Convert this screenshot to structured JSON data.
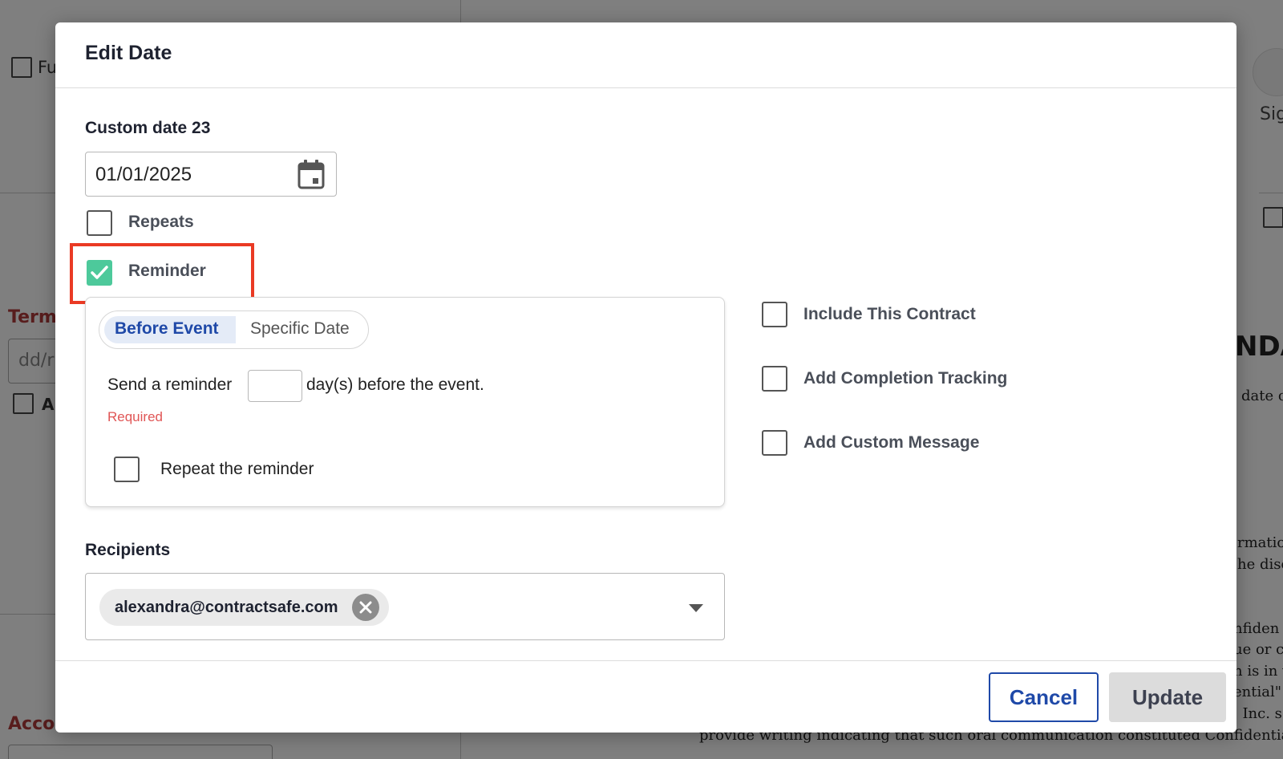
{
  "modal": {
    "title": "Edit Date",
    "date_label": "Custom date 23",
    "date_value": "01/01/2025",
    "repeats_label": "Repeats",
    "reminder_label": "Reminder",
    "reminder_checked": true,
    "reminder_box": {
      "tab_active": "Before Event",
      "tab_inactive": "Specific Date",
      "send_prefix": "Send a reminder",
      "send_suffix": "day(s) before the event.",
      "days_value": "",
      "required": "Required",
      "repeat_label": "Repeat the reminder"
    },
    "options": [
      "Include This Contract",
      "Add Completion Tracking",
      "Add Custom Message"
    ],
    "recipients_label": "Recipients",
    "recipient_email": "alexandra@contractsafe.com",
    "cancel_label": "Cancel",
    "update_label": "Update"
  },
  "background": {
    "left_checkbox_label": "Fu",
    "term_label": "Term",
    "date_placeholder": "dd/r",
    "small_label": "A",
    "account_label": "Acco",
    "right_label": "Sig",
    "doc_heading": "NDA",
    "doc_lines": [
      "date o",
      "rmatio",
      "he discl",
      "nfiden",
      "ue or  c",
      "n is in  v",
      "ential\"",
      ", Inc.  s",
      "provide writing indicating that such oral communication constituted Confidential  Info"
    ]
  },
  "colors": {
    "accent": "#1f49a8",
    "check": "#4dc99b",
    "highlight": "#ea3a24",
    "required": "#e05555"
  }
}
